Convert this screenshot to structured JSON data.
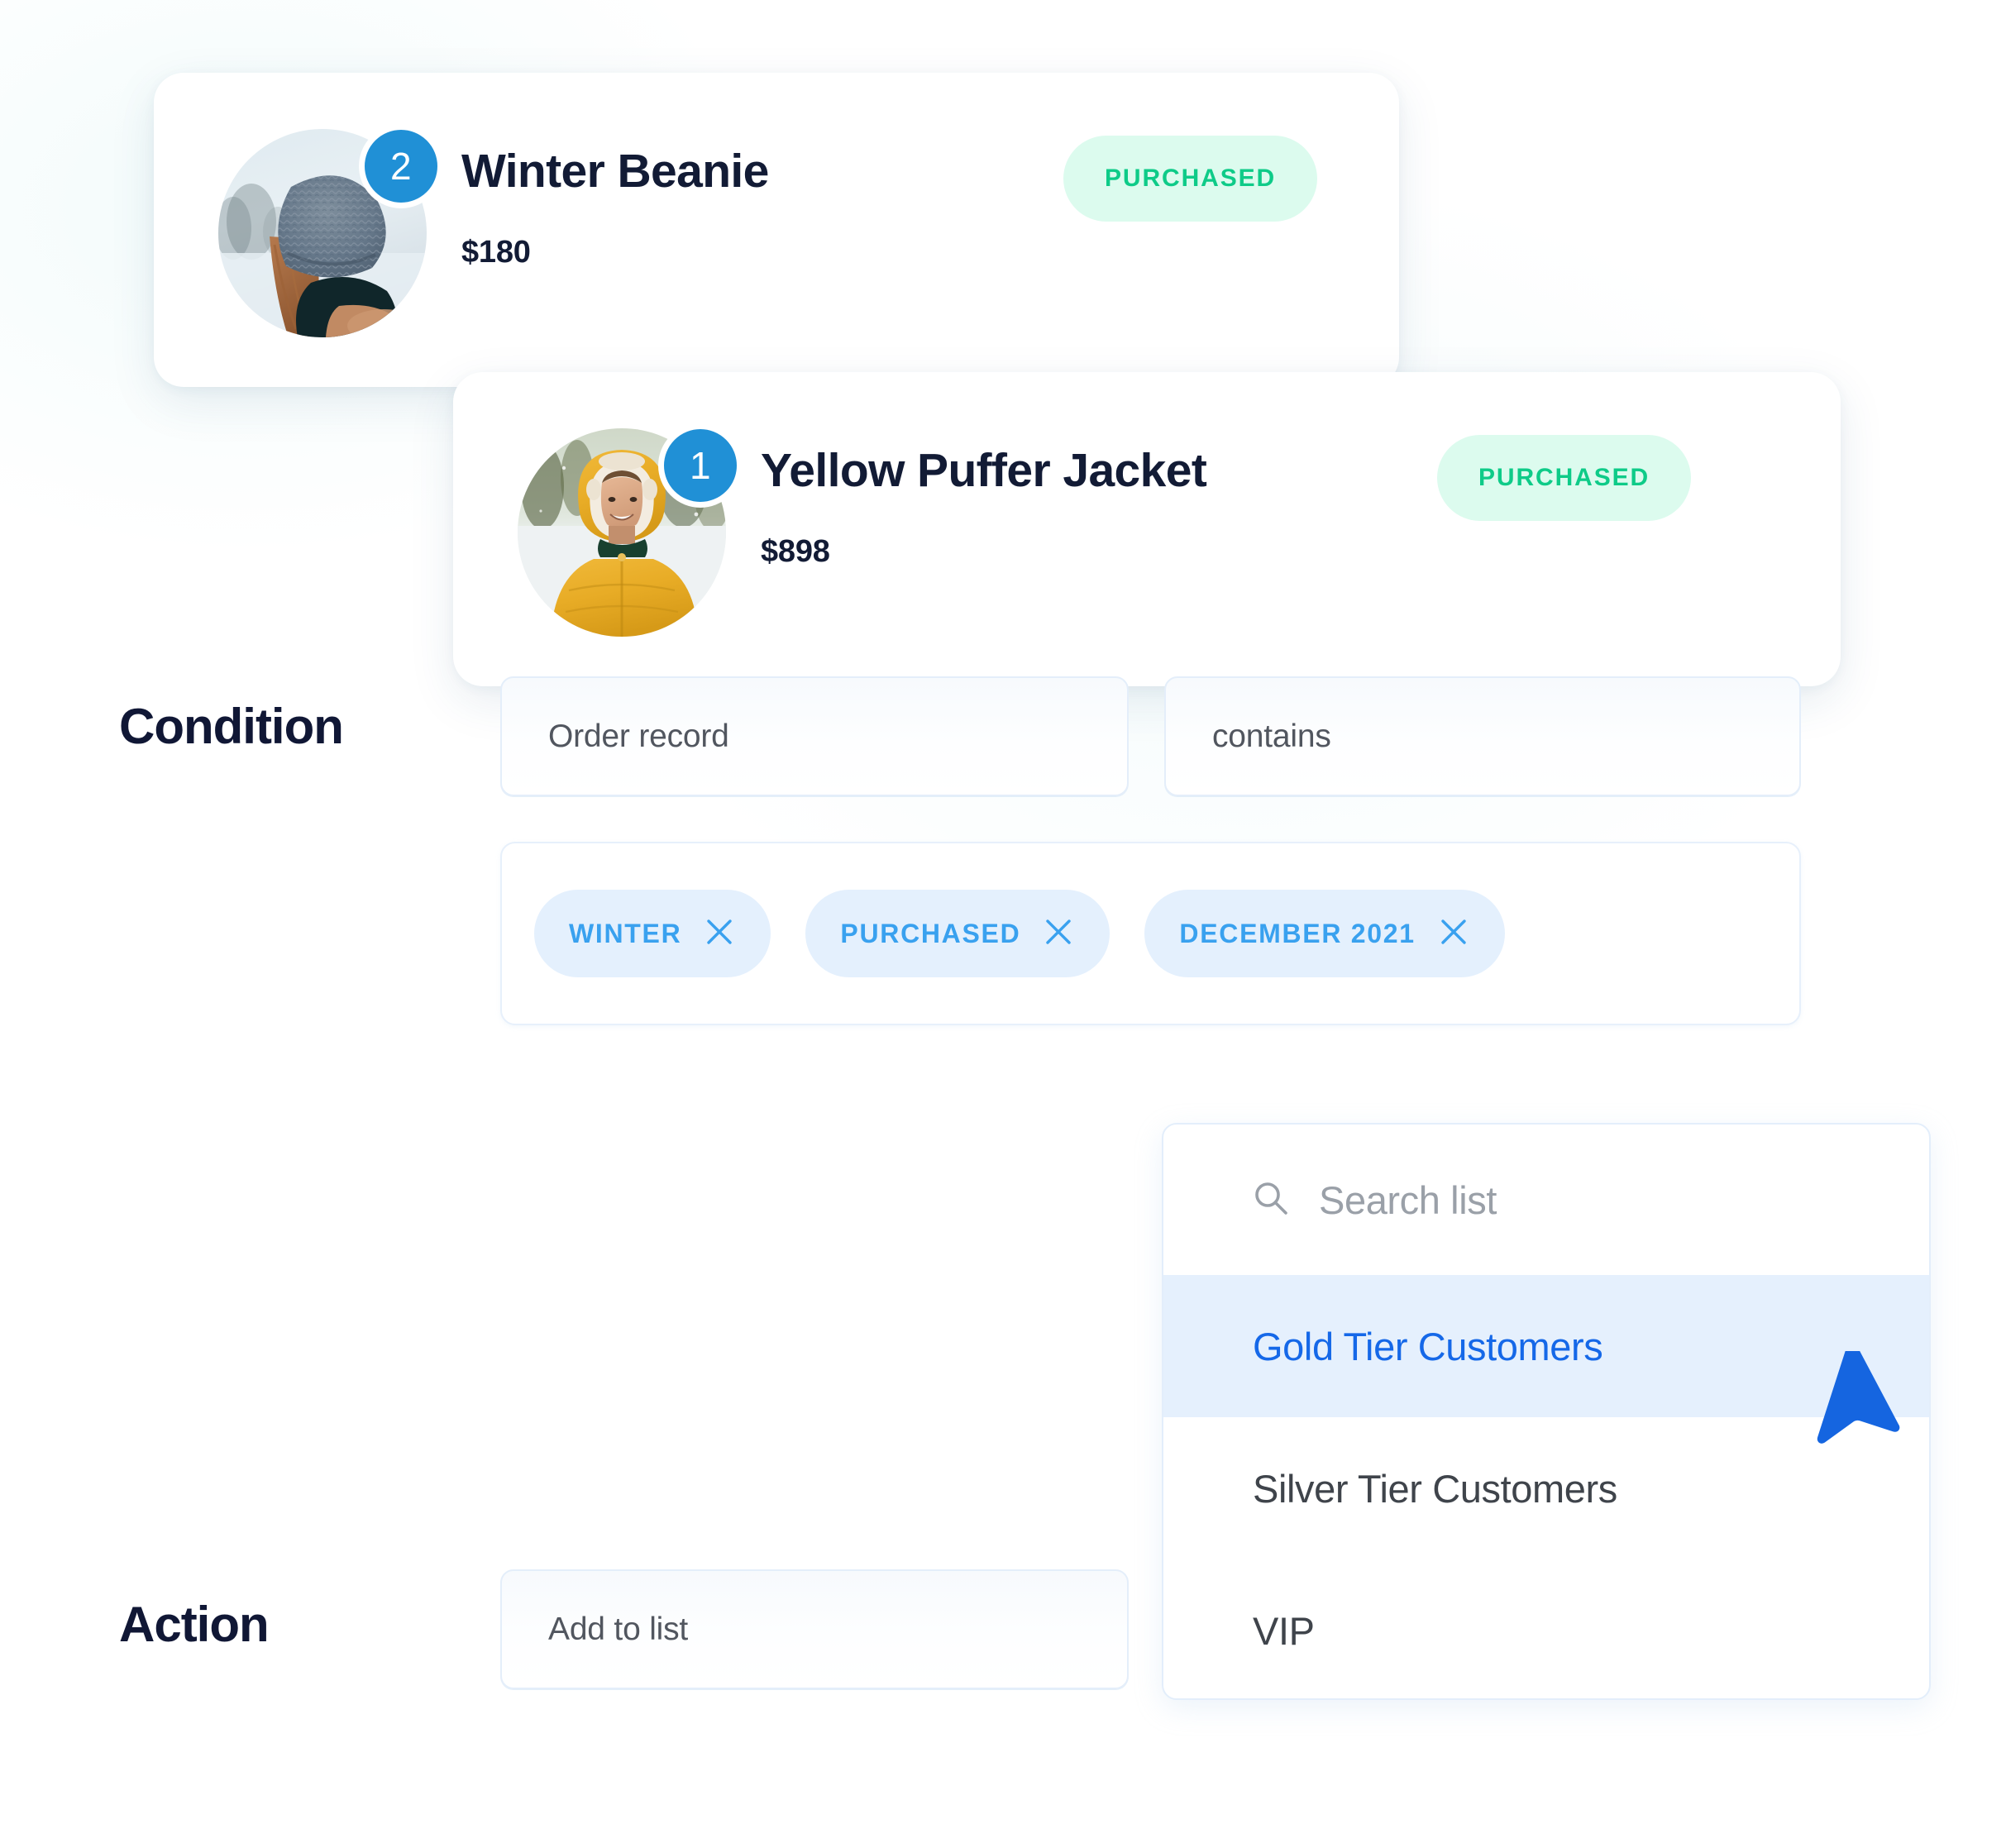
{
  "products": [
    {
      "count": "2",
      "title": "Winter Beanie",
      "price": "$180",
      "status": "PURCHASED",
      "image_alt": "winter-beanie-photo"
    },
    {
      "count": "1",
      "title": "Yellow Puffer Jacket",
      "price": "$898",
      "status": "PURCHASED",
      "image_alt": "yellow-puffer-jacket-photo"
    }
  ],
  "condition": {
    "label": "Condition",
    "field_record": "Order record",
    "field_operator": "contains",
    "chips": [
      {
        "label": "WINTER"
      },
      {
        "label": "PURCHASED"
      },
      {
        "label": "DECEMBER 2021"
      }
    ]
  },
  "action": {
    "label": "Action",
    "field_action": "Add to list"
  },
  "dropdown": {
    "search_placeholder": "Search list",
    "items": [
      {
        "label": "Gold Tier Customers",
        "selected": true
      },
      {
        "label": "Silver Tier Customers",
        "selected": false
      },
      {
        "label": "VIP",
        "selected": false
      }
    ]
  },
  "colors": {
    "badge_blue": "#2090d6",
    "status_green": "#0ecb88",
    "status_green_bg": "#dcfbee",
    "chip_blue": "#39a1ef",
    "chip_bg": "#e4f0fd",
    "selected_blue": "#1568e8",
    "selected_bg": "#e5f0fd",
    "cursor_blue": "#1565e0",
    "text_dark": "#121b35"
  }
}
